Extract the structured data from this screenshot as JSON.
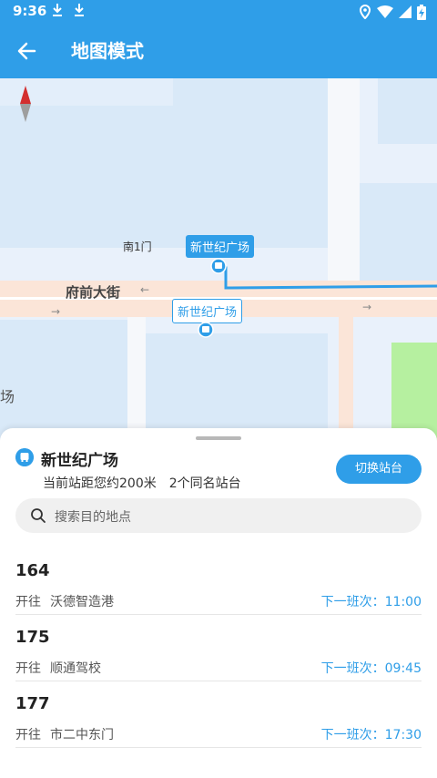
{
  "status_bar": {
    "time": "9:36",
    "icons": [
      "download-icon",
      "download-icon",
      "location-icon",
      "wifi-icon",
      "signal-icon",
      "battery-charging-icon"
    ]
  },
  "app_bar": {
    "title": "地图模式"
  },
  "map": {
    "street_label": "府前大街",
    "gate_label": "南1门",
    "partial_label": "场",
    "stop_active": "新世纪广场",
    "stop_inactive": "新世纪广场"
  },
  "sheet": {
    "station_name": "新世纪广场",
    "distance_text": "当前站距您约200米　2个同名站台",
    "switch_button": "切换站台",
    "search_placeholder": "搜索目的地点",
    "routes": [
      {
        "number": "164",
        "towards_label": "开往",
        "destination": "沃德智造港",
        "next_label": "下一班次：11:00"
      },
      {
        "number": "175",
        "towards_label": "开往",
        "destination": "顺通驾校",
        "next_label": "下一班次：09:45"
      },
      {
        "number": "177",
        "towards_label": "开往",
        "destination": "市二中东门",
        "next_label": "下一班次：17:30"
      }
    ]
  },
  "colors": {
    "primary": "#2f9ee8",
    "map_block": "#d9e9f8",
    "road": "#fbe5d8",
    "park": "#b6f0a0"
  }
}
